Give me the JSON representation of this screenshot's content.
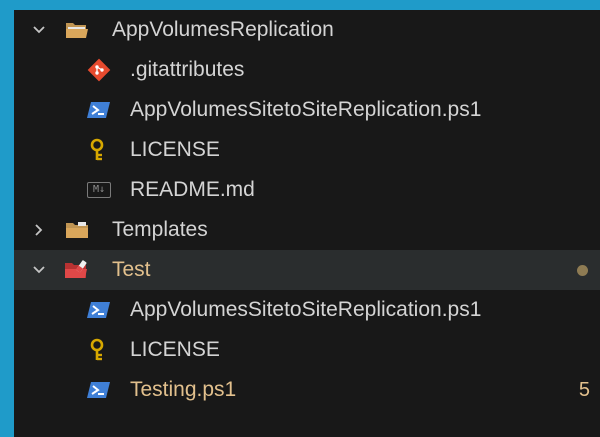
{
  "explorer": {
    "items": [
      {
        "label": "AppVolumesReplication",
        "kind": "folder",
        "expanded": true
      },
      {
        "label": ".gitattributes",
        "kind": "git"
      },
      {
        "label": "AppVolumesSitetoSiteReplication.ps1",
        "kind": "powershell"
      },
      {
        "label": "LICENSE",
        "kind": "license"
      },
      {
        "label": "README.md",
        "kind": "markdown",
        "icon_text": "M↓"
      },
      {
        "label": "Templates",
        "kind": "folder",
        "expanded": false
      },
      {
        "label": "Test",
        "kind": "test-folder",
        "expanded": true,
        "modified": true
      },
      {
        "label": "AppVolumesSitetoSiteReplication.ps1",
        "kind": "powershell"
      },
      {
        "label": "LICENSE",
        "kind": "license"
      },
      {
        "label": "Testing.ps1",
        "kind": "powershell",
        "modified": true,
        "problems": "5"
      }
    ]
  },
  "colors": {
    "background": "#1f9bc9",
    "panel": "#181818",
    "text": "#d4d4d4",
    "modified_text": "#e2c08d",
    "folder": "#c09553",
    "powershell": "#3f7fd6",
    "git": "#e64a2e",
    "license": "#d7a800",
    "test_folder": "#e04848"
  }
}
